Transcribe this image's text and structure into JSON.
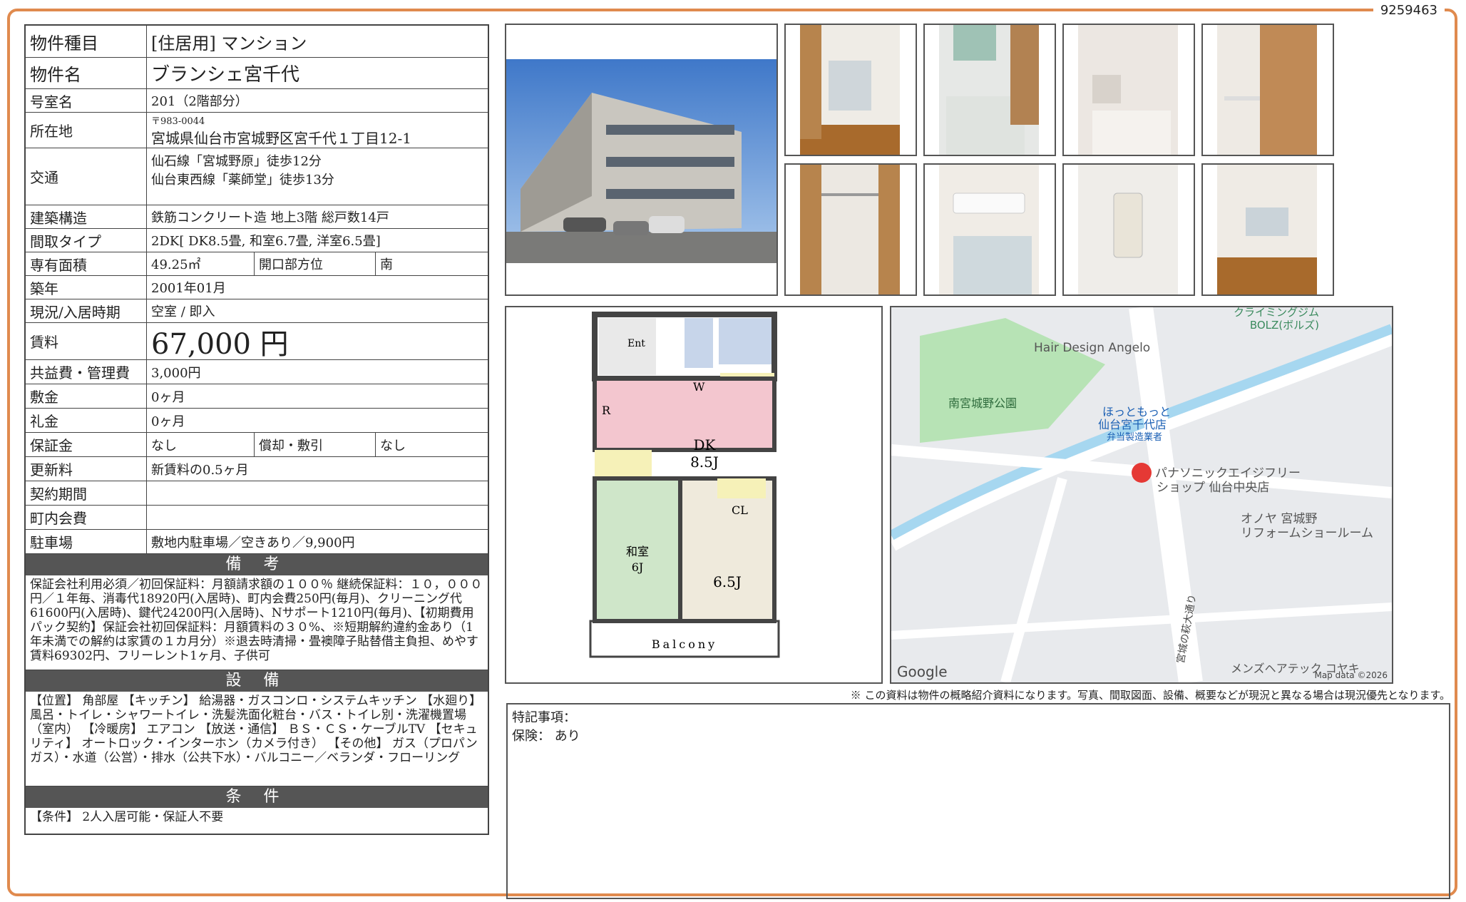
{
  "doc_id": "9259463",
  "property": {
    "rows": [
      {
        "label": "物件種目",
        "value": "[住居用]  マンション"
      },
      {
        "label": "物件名",
        "value": "ブランシェ宮千代"
      },
      {
        "label": "号室名",
        "value": "201（2階部分）"
      },
      {
        "label": "所在地",
        "postal": "〒983-0044",
        "value": "宮城県仙台市宮城野区宮千代１丁目12-1"
      },
      {
        "label": "交通",
        "line1": "仙石線「宮城野原」徒歩12分",
        "line2": "仙台東西線「薬師堂」徒歩13分"
      },
      {
        "label": "建築構造",
        "value": "鉄筋コンクリート造  地上3階  総戸数14戸"
      },
      {
        "label": "間取タイプ",
        "value": "2DK[ DK8.5畳, 和室6.7畳, 洋室6.5畳]"
      },
      {
        "label": "専有面積",
        "value": "49.25㎡",
        "sub_label": "開口部方位",
        "sub_value": "南"
      },
      {
        "label": "築年",
        "value": "2001年01月"
      },
      {
        "label": "現況/入居時期",
        "value": "空室  /  即入"
      },
      {
        "label": "賃料",
        "value": "67,000  円"
      },
      {
        "label": "共益費・管理費",
        "value": "3,000円"
      },
      {
        "label": "敷金",
        "value": "0ヶ月"
      },
      {
        "label": "礼金",
        "value": "0ヶ月"
      },
      {
        "label": "保証金",
        "value": "なし",
        "sub_label": "償却・敷引",
        "sub_value": "なし"
      },
      {
        "label": "更新料",
        "value": "新賃料の0.5ヶ月"
      },
      {
        "label": "契約期間",
        "value": ""
      },
      {
        "label": "町内会費",
        "value": ""
      },
      {
        "label": "駐車場",
        "value": "敷地内駐車場／空きあり／9,900円"
      }
    ]
  },
  "sections": {
    "remarks_title": "備  考",
    "remarks": "保証会社利用必須／初回保証料：月額請求額の１００％  継続保証料：１０，０００円／１年毎、消毒代18920円(入居時)、町内会費250円(毎月)、クリーニング代61600円(入居時)、鍵代24200円(入居時)、Nサポート1210円(毎月)、【初期費用パック契約】保証会社初回保証料：月額賃料の３０%、※短期解約違約金あり（1年未満での解約は家賃の１カ月分）※退去時清掃・畳襖障子貼替借主負担、めやす賃料69302円、フリーレント1ヶ月、子供可",
    "equipment_title": "設  備",
    "equipment": "【位置】 角部屋 【キッチン】 給湯器・ガスコンロ・システムキッチン 【水廻り】 風呂・トイレ・シャワートイレ・洗髪洗面化粧台・バス・トイレ別・洗濯機置場（室内） 【冷暖房】 エアコン 【放送・通信】 ＢＳ・ＣＳ・ケーブルTV 【セキュリティ】 オートロック・インターホン（カメラ付き） 【その他】 ガス（プロパンガス）・水道（公営）・排水（公共下水）・バルコニー／ベランダ・フローリング",
    "conditions_title": "条  件",
    "conditions": "【条件】 2人入居可能・保証人不要"
  },
  "floorplan": {
    "ent": "Ent",
    "w": "W",
    "r": "R",
    "dk": "DK",
    "dk_size": "8.5J",
    "cl": "CL",
    "washitsu": "和室",
    "washitsu_size": "6J",
    "youshitsu_size": "6.5J",
    "balcony": "Balcony"
  },
  "map": {
    "labels": {
      "climbing": "クライミングジム\nBOLZ(ボルズ)",
      "hair": "Hair Design Angelo",
      "park": "南宮城野公園",
      "hotto": "ほっともっと\n仙台宮千代店",
      "hotto_sub": "弁当製造業者",
      "panasonic": "パナソニックエイジフリー\nショップ 仙台中央店",
      "onoya": "オノヤ 宮城野\nリフォームショールーム",
      "mens": "メンズヘアテック コヤキ",
      "road": "宮城の萩大通り",
      "google": "Google",
      "mapdata": "Map data ©2026"
    }
  },
  "disclaimer": "※  この資料は物件の概略紹介資料になります。写真、間取図面、設備、概要などが現況と異なる場合は現況優先となります。",
  "special": {
    "title": "特記事項：",
    "insurance": "保険：  あり"
  }
}
